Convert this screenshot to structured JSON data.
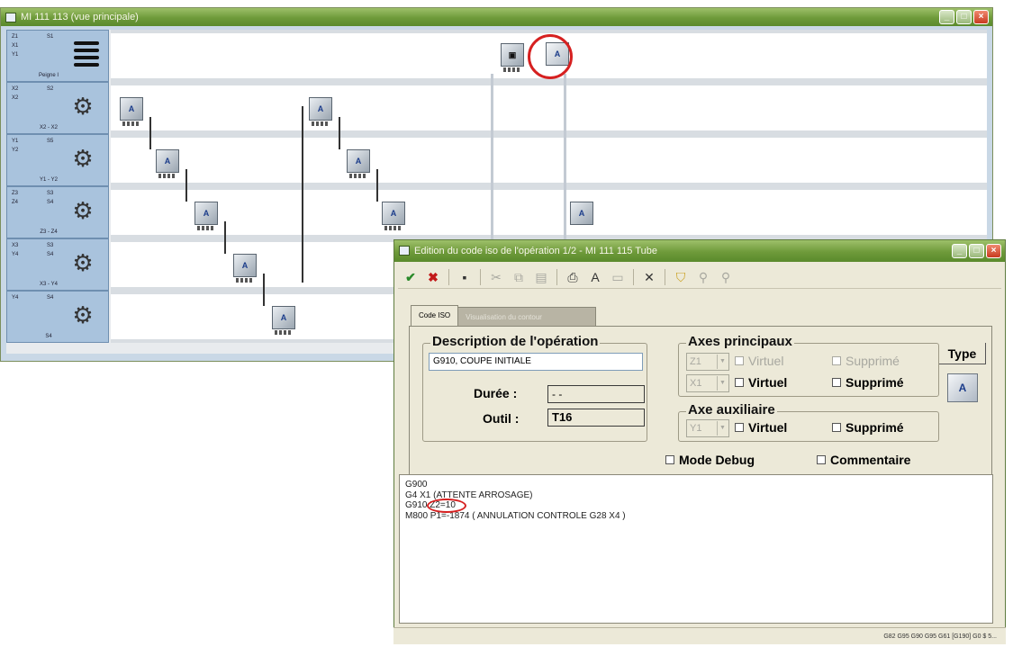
{
  "main_window": {
    "title": "MI 111 113 (vue principale)",
    "rows": [
      {
        "axes_left": [
          "Z1",
          "X1",
          "Y1"
        ],
        "axes_right": [
          "S1"
        ],
        "name": "Peigne I",
        "icon": "tool-stack-icon"
      },
      {
        "axes_left": [
          "X2",
          "X2"
        ],
        "axes_right": [
          "S2"
        ],
        "name": "X2 - X2",
        "icon": "gear-icon"
      },
      {
        "axes_left": [
          "Y1",
          "Y2"
        ],
        "axes_right": [
          "S5"
        ],
        "name": "Y1 - Y2",
        "icon": "gear-icon"
      },
      {
        "axes_left": [
          "Z3",
          "Z4"
        ],
        "axes_right": [
          "S3",
          "S4"
        ],
        "name": "Z3 - Z4",
        "icon": "gear-icon"
      },
      {
        "axes_left": [
          "X3",
          "Y4"
        ],
        "axes_right": [
          "S3",
          "S4"
        ],
        "name": "X3 - Y4",
        "icon": "gear-icon"
      },
      {
        "axes_left": [
          "Y4"
        ],
        "axes_right": [
          "S4"
        ],
        "name": "S4",
        "icon": "gear-icon"
      }
    ],
    "op_icon_text": "A"
  },
  "dialog": {
    "title": "Edition du code iso de l'opération 1/2 - MI 111 115 Tube",
    "tabs": [
      {
        "label": "Code ISO"
      },
      {
        "label": "Visualisation du contour"
      }
    ],
    "description": {
      "group_title": "Description de l'opération",
      "value": "G910, COUPE INITIALE"
    },
    "duree": {
      "label": "Durée :",
      "value": "- -"
    },
    "outil": {
      "label": "Outil :",
      "value": "T16"
    },
    "axes_principaux": {
      "group_title": "Axes principaux",
      "rows": [
        {
          "axis": "Z1",
          "virtuel": "Virtuel",
          "supprime": "Supprimé",
          "enabled": false
        },
        {
          "axis": "X1",
          "virtuel": "Virtuel",
          "supprime": "Supprimé",
          "enabled": true
        }
      ]
    },
    "axe_auxiliaire": {
      "group_title": "Axe auxiliaire",
      "axis": "Y1",
      "virtuel": "Virtuel",
      "supprime": "Supprimé"
    },
    "mode_debug": "Mode Debug",
    "commentaire": "Commentaire",
    "type_button": "Type",
    "code_lines": [
      "G900",
      "G4 X1 (ATTENTE ARROSAGE)",
      "G910 Z2=10",
      "M800 P1=-1874 ( ANNULATION CONTROLE G28 X4 )"
    ],
    "status_text": "G82 G95 G90 G95 G61 [G190] G0 $   5..."
  }
}
